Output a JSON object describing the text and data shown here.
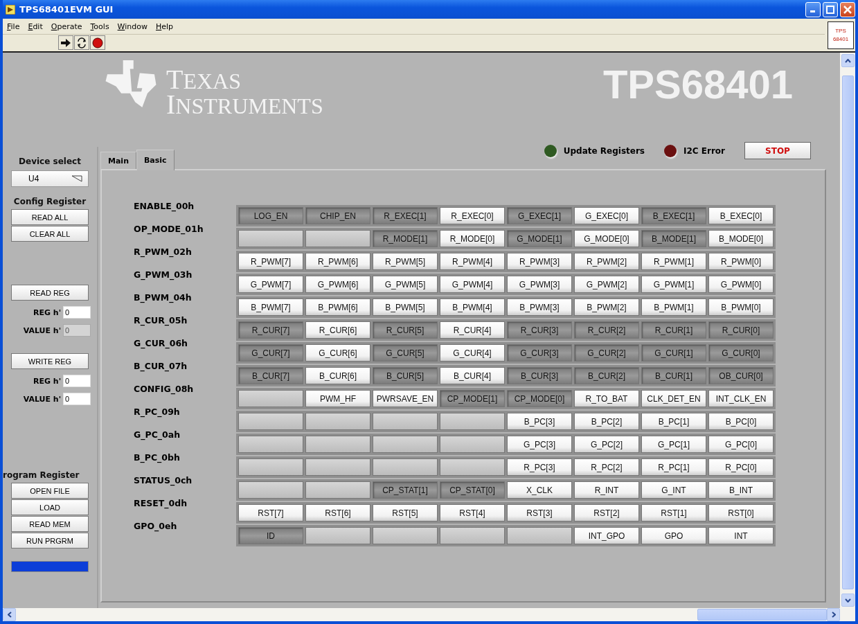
{
  "window": {
    "title": "TPS68401EVM GUI"
  },
  "menu": [
    "File",
    "Edit",
    "Operate",
    "Tools",
    "Window",
    "Help"
  ],
  "vi_icon": [
    "TPS",
    "68401"
  ],
  "logo": {
    "line1": "TEXAS",
    "line2": "INSTRUMENTS"
  },
  "product_title": "TPS68401",
  "sidebar": {
    "device_label": "Device select",
    "device_value": "U4",
    "config_title": "Config Register",
    "config_buttons": [
      "READ ALL",
      "CLEAR ALL"
    ],
    "read_button": "READ REG",
    "read_fields": [
      {
        "label": "REG h'",
        "value": "0",
        "disabled": false
      },
      {
        "label": "VALUE h'",
        "value": "0",
        "disabled": true
      }
    ],
    "write_button": "WRITE REG",
    "write_fields": [
      {
        "label": "REG h'",
        "value": "0",
        "disabled": false
      },
      {
        "label": "VALUE h'",
        "value": "0",
        "disabled": false
      }
    ],
    "program_title": "rogram Register",
    "program_buttons": [
      "OPEN FILE",
      "LOAD",
      "READ MEM",
      "RUN PRGRM"
    ],
    "progress": {
      "level": 1
    }
  },
  "tabs": [
    {
      "label": "Main",
      "selected": false
    },
    {
      "label": "Basic",
      "selected": true
    }
  ],
  "indicators": [
    {
      "label": "Update Registers",
      "color": "#2f5a22"
    },
    {
      "label": "I2C Error",
      "color": "#6b1010"
    }
  ],
  "stop_button": "STOP",
  "registers": [
    {
      "name": "ENABLE_00h",
      "bits": [
        {
          "kind": "bit",
          "label": "LOG_EN",
          "on": true
        },
        {
          "kind": "bit",
          "label": "CHIP_EN",
          "on": true
        },
        {
          "kind": "bit",
          "label": "R_EXEC[1]",
          "on": true
        },
        {
          "kind": "bit",
          "label": "R_EXEC[0]",
          "on": false
        },
        {
          "kind": "bit",
          "label": "G_EXEC[1]",
          "on": true
        },
        {
          "kind": "bit",
          "label": "G_EXEC[0]",
          "on": false
        },
        {
          "kind": "bit",
          "label": "B_EXEC[1]",
          "on": true
        },
        {
          "kind": "bit",
          "label": "B_EXEC[0]",
          "on": false
        }
      ]
    },
    {
      "name": "OP_MODE_01h",
      "bits": [
        {
          "kind": "blank"
        },
        {
          "kind": "blank"
        },
        {
          "kind": "bit",
          "label": "R_MODE[1]",
          "on": true
        },
        {
          "kind": "bit",
          "label": "R_MODE[0]",
          "on": false
        },
        {
          "kind": "bit",
          "label": "G_MODE[1]",
          "on": true
        },
        {
          "kind": "bit",
          "label": "G_MODE[0]",
          "on": false
        },
        {
          "kind": "bit",
          "label": "B_MODE[1]",
          "on": true
        },
        {
          "kind": "bit",
          "label": "B_MODE[0]",
          "on": false
        }
      ]
    },
    {
      "name": "R_PWM_02h",
      "bits": [
        {
          "kind": "bit",
          "label": "R_PWM[7]",
          "on": false
        },
        {
          "kind": "bit",
          "label": "R_PWM[6]",
          "on": false
        },
        {
          "kind": "bit",
          "label": "R_PWM[5]",
          "on": false
        },
        {
          "kind": "bit",
          "label": "R_PWM[4]",
          "on": false
        },
        {
          "kind": "bit",
          "label": "R_PWM[3]",
          "on": false
        },
        {
          "kind": "bit",
          "label": "R_PWM[2]",
          "on": false
        },
        {
          "kind": "bit",
          "label": "R_PWM[1]",
          "on": false
        },
        {
          "kind": "bit",
          "label": "R_PWM[0]",
          "on": false
        }
      ]
    },
    {
      "name": "G_PWM_03h",
      "bits": [
        {
          "kind": "bit",
          "label": "G_PWM[7]",
          "on": false
        },
        {
          "kind": "bit",
          "label": "G_PWM[6]",
          "on": false
        },
        {
          "kind": "bit",
          "label": "G_PWM[5]",
          "on": false
        },
        {
          "kind": "bit",
          "label": "G_PWM[4]",
          "on": false
        },
        {
          "kind": "bit",
          "label": "G_PWM[3]",
          "on": false
        },
        {
          "kind": "bit",
          "label": "G_PWM[2]",
          "on": false
        },
        {
          "kind": "bit",
          "label": "G_PWM[1]",
          "on": false
        },
        {
          "kind": "bit",
          "label": "G_PWM[0]",
          "on": false
        }
      ]
    },
    {
      "name": "B_PWM_04h",
      "bits": [
        {
          "kind": "bit",
          "label": "B_PWM[7]",
          "on": false
        },
        {
          "kind": "bit",
          "label": "B_PWM[6]",
          "on": false
        },
        {
          "kind": "bit",
          "label": "B_PWM[5]",
          "on": false
        },
        {
          "kind": "bit",
          "label": "B_PWM[4]",
          "on": false
        },
        {
          "kind": "bit",
          "label": "B_PWM[3]",
          "on": false
        },
        {
          "kind": "bit",
          "label": "B_PWM[2]",
          "on": false
        },
        {
          "kind": "bit",
          "label": "B_PWM[1]",
          "on": false
        },
        {
          "kind": "bit",
          "label": "B_PWM[0]",
          "on": false
        }
      ]
    },
    {
      "name": "R_CUR_05h",
      "bits": [
        {
          "kind": "bit",
          "label": "R_CUR[7]",
          "on": true
        },
        {
          "kind": "bit",
          "label": "R_CUR[6]",
          "on": false
        },
        {
          "kind": "bit",
          "label": "R_CUR[5]",
          "on": true
        },
        {
          "kind": "bit",
          "label": "R_CUR[4]",
          "on": false
        },
        {
          "kind": "bit",
          "label": "R_CUR[3]",
          "on": true
        },
        {
          "kind": "bit",
          "label": "R_CUR[2]",
          "on": true
        },
        {
          "kind": "bit",
          "label": "R_CUR[1]",
          "on": true
        },
        {
          "kind": "bit",
          "label": "R_CUR[0]",
          "on": true
        }
      ]
    },
    {
      "name": "G_CUR_06h",
      "bits": [
        {
          "kind": "bit",
          "label": "G_CUR[7]",
          "on": true
        },
        {
          "kind": "bit",
          "label": "G_CUR[6]",
          "on": false
        },
        {
          "kind": "bit",
          "label": "G_CUR[5]",
          "on": true
        },
        {
          "kind": "bit",
          "label": "G_CUR[4]",
          "on": false
        },
        {
          "kind": "bit",
          "label": "G_CUR[3]",
          "on": true
        },
        {
          "kind": "bit",
          "label": "G_CUR[2]",
          "on": true
        },
        {
          "kind": "bit",
          "label": "G_CUR[1]",
          "on": true
        },
        {
          "kind": "bit",
          "label": "G_CUR[0]",
          "on": true
        }
      ]
    },
    {
      "name": "B_CUR_07h",
      "bits": [
        {
          "kind": "bit",
          "label": "B_CUR[7]",
          "on": true
        },
        {
          "kind": "bit",
          "label": "B_CUR[6]",
          "on": false
        },
        {
          "kind": "bit",
          "label": "B_CUR[5]",
          "on": true
        },
        {
          "kind": "bit",
          "label": "B_CUR[4]",
          "on": false
        },
        {
          "kind": "bit",
          "label": "B_CUR[3]",
          "on": true
        },
        {
          "kind": "bit",
          "label": "B_CUR[2]",
          "on": true
        },
        {
          "kind": "bit",
          "label": "B_CUR[1]",
          "on": true
        },
        {
          "kind": "bit",
          "label": "OB_CUR[0]",
          "on": true
        }
      ]
    },
    {
      "name": "CONFIG_08h",
      "bits": [
        {
          "kind": "blank"
        },
        {
          "kind": "bit",
          "label": "PWM_HF",
          "on": false
        },
        {
          "kind": "bit",
          "label": "PWRSAVE_EN",
          "on": false
        },
        {
          "kind": "bit",
          "label": "CP_MODE[1]",
          "on": true
        },
        {
          "kind": "bit",
          "label": "CP_MODE[0]",
          "on": true
        },
        {
          "kind": "bit",
          "label": "R_TO_BAT",
          "on": false
        },
        {
          "kind": "bit",
          "label": "CLK_DET_EN",
          "on": false
        },
        {
          "kind": "bit",
          "label": "INT_CLK_EN",
          "on": false
        }
      ]
    },
    {
      "name": "R_PC_09h",
      "bits": [
        {
          "kind": "blank"
        },
        {
          "kind": "blank"
        },
        {
          "kind": "blank"
        },
        {
          "kind": "blank"
        },
        {
          "kind": "bit",
          "label": "B_PC[3]",
          "on": false
        },
        {
          "kind": "bit",
          "label": "B_PC[2]",
          "on": false
        },
        {
          "kind": "bit",
          "label": "B_PC[1]",
          "on": false
        },
        {
          "kind": "bit",
          "label": "B_PC[0]",
          "on": false
        }
      ]
    },
    {
      "name": "G_PC_0ah",
      "bits": [
        {
          "kind": "blank"
        },
        {
          "kind": "blank"
        },
        {
          "kind": "blank"
        },
        {
          "kind": "blank"
        },
        {
          "kind": "bit",
          "label": "G_PC[3]",
          "on": false
        },
        {
          "kind": "bit",
          "label": "G_PC[2]",
          "on": false
        },
        {
          "kind": "bit",
          "label": "G_PC[1]",
          "on": false
        },
        {
          "kind": "bit",
          "label": "G_PC[0]",
          "on": false
        }
      ]
    },
    {
      "name": "B_PC_0bh",
      "bits": [
        {
          "kind": "blank"
        },
        {
          "kind": "blank"
        },
        {
          "kind": "blank"
        },
        {
          "kind": "blank"
        },
        {
          "kind": "bit",
          "label": "R_PC[3]",
          "on": false
        },
        {
          "kind": "bit",
          "label": "R_PC[2]",
          "on": false
        },
        {
          "kind": "bit",
          "label": "R_PC[1]",
          "on": false
        },
        {
          "kind": "bit",
          "label": "R_PC[0]",
          "on": false
        }
      ]
    },
    {
      "name": "STATUS_0ch",
      "bits": [
        {
          "kind": "blank"
        },
        {
          "kind": "blank"
        },
        {
          "kind": "bit",
          "label": "CP_STAT[1]",
          "on": true
        },
        {
          "kind": "bit",
          "label": "CP_STAT[0]",
          "on": true
        },
        {
          "kind": "bit",
          "label": "X_CLK",
          "on": false
        },
        {
          "kind": "bit",
          "label": "R_INT",
          "on": false
        },
        {
          "kind": "bit",
          "label": "G_INT",
          "on": false
        },
        {
          "kind": "bit",
          "label": "B_INT",
          "on": false
        }
      ]
    },
    {
      "name": "RESET_0dh",
      "bits": [
        {
          "kind": "bit",
          "label": "RST[7]",
          "on": false
        },
        {
          "kind": "bit",
          "label": "RST[6]",
          "on": false
        },
        {
          "kind": "bit",
          "label": "RST[5]",
          "on": false
        },
        {
          "kind": "bit",
          "label": "RST[4]",
          "on": false
        },
        {
          "kind": "bit",
          "label": "RST[3]",
          "on": false
        },
        {
          "kind": "bit",
          "label": "RST[2]",
          "on": false
        },
        {
          "kind": "bit",
          "label": "RST[1]",
          "on": false
        },
        {
          "kind": "bit",
          "label": "RST[0]",
          "on": false
        }
      ]
    },
    {
      "name": "GPO_0eh",
      "bits": [
        {
          "kind": "bit",
          "label": "ID",
          "on": true
        },
        {
          "kind": "blank"
        },
        {
          "kind": "blank"
        },
        {
          "kind": "blank"
        },
        {
          "kind": "blank"
        },
        {
          "kind": "bit",
          "label": "INT_GPO",
          "on": false
        },
        {
          "kind": "bit",
          "label": "GPO",
          "on": false
        },
        {
          "kind": "bit",
          "label": "INT",
          "on": false
        }
      ]
    }
  ]
}
